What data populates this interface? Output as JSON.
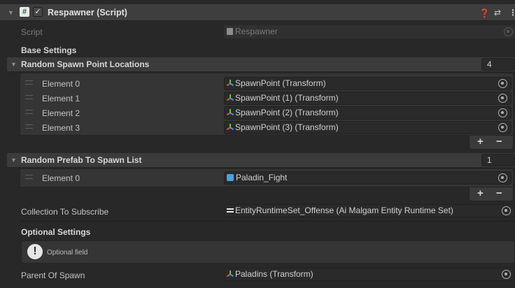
{
  "component": {
    "title": "Respawner (Script)",
    "icons": {
      "fold": "triangle-down-icon",
      "script": "hash-icon",
      "enabled": "checkmark-icon",
      "help": "help-icon",
      "presets": "sliders-icon",
      "menu": "kebab-icon"
    },
    "glyphs": {
      "fold": "▼",
      "hash": "#",
      "check": "✓",
      "help": "❓",
      "presets": "⇄",
      "menu": "⋮",
      "plus": "+",
      "minus": "−",
      "drag": "=",
      "exclaim": "!"
    }
  },
  "script_row": {
    "label": "Script",
    "value": "Respawner"
  },
  "base_settings": {
    "header": "Base Settings"
  },
  "spawn_points": {
    "label": "Random Spawn Point Locations",
    "count": "4",
    "elements": [
      {
        "label": "Element 0",
        "value": "SpawnPoint (Transform)"
      },
      {
        "label": "Element 1",
        "value": "SpawnPoint (1) (Transform)"
      },
      {
        "label": "Element 2",
        "value": "SpawnPoint (2) (Transform)"
      },
      {
        "label": "Element 3",
        "value": "SpawnPoint (3) (Transform)"
      }
    ]
  },
  "prefab_list": {
    "label": "Random Prefab To Spawn List",
    "count": "1",
    "elements": [
      {
        "label": "Element 0",
        "value": "Paladin_Fight"
      }
    ]
  },
  "collection": {
    "label": "Collection To Subscribe",
    "value": "EntityRuntimeSet_Offense (Ai Malgam Entity Runtime Set)"
  },
  "optional_settings": {
    "header": "Optional Settings",
    "help_text": "Optional field"
  },
  "parent": {
    "label": "Parent Of Spawn",
    "value": "Paladins (Transform)"
  },
  "colors": {
    "background": "#282828",
    "field": "#2a2a2a",
    "header": "#3e3e3e",
    "prefab": "#47a3e0"
  }
}
